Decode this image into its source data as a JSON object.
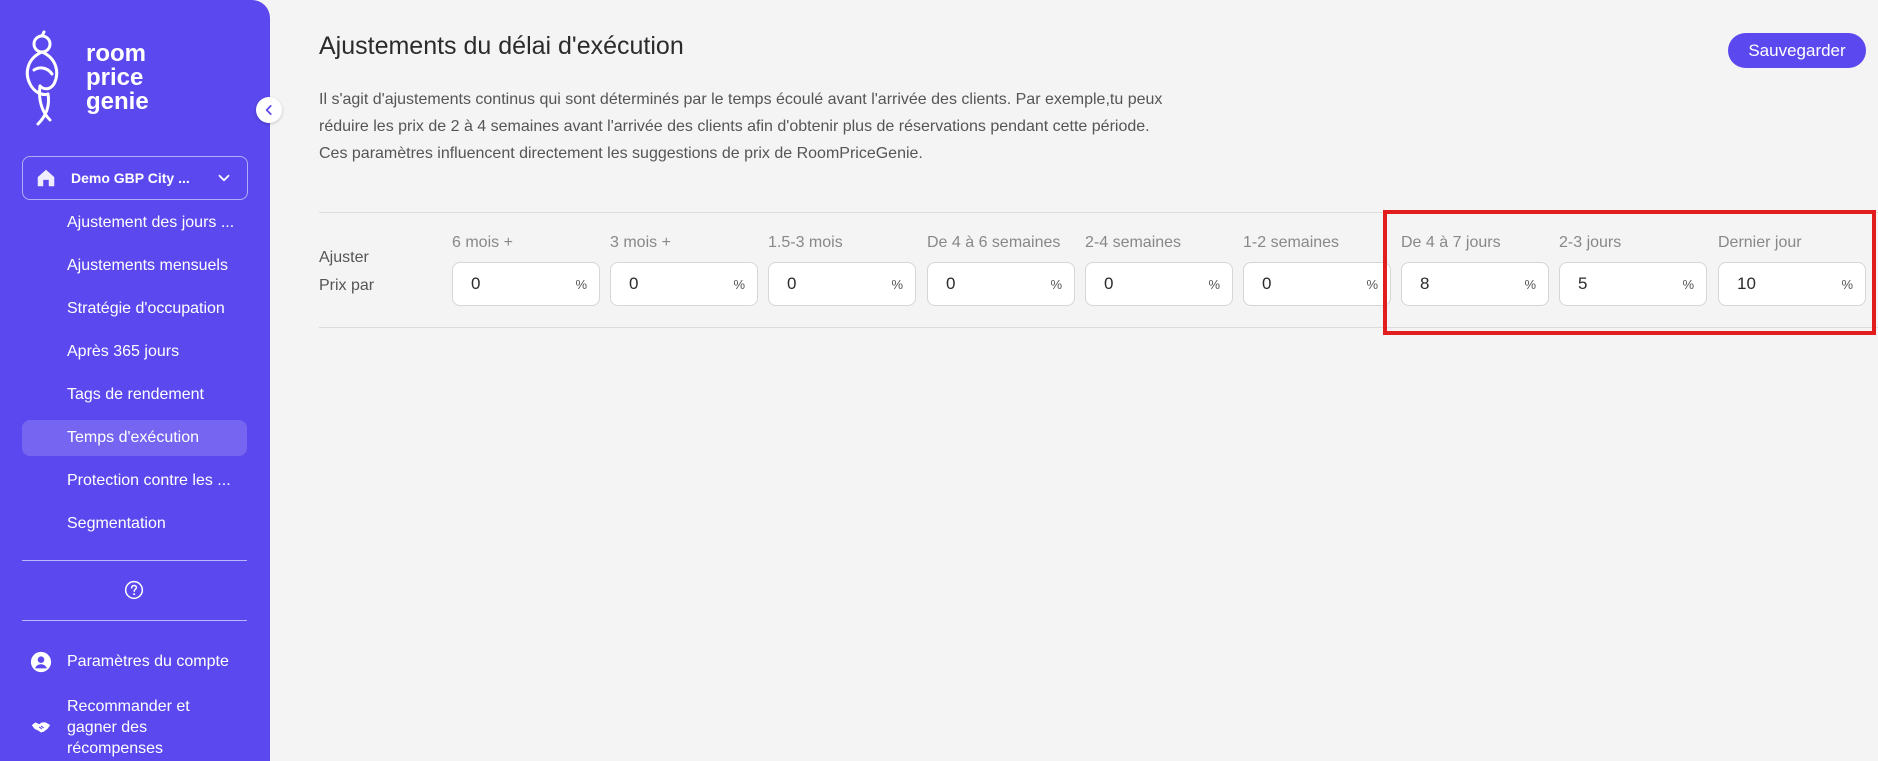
{
  "brand": {
    "logo_lines": [
      "room",
      "price",
      "genie"
    ]
  },
  "sidebar": {
    "hotel_selector": "Demo GBP City ...",
    "items": [
      {
        "label": "Ajustement des jours ...",
        "active": false
      },
      {
        "label": "Ajustements mensuels",
        "active": false
      },
      {
        "label": "Stratégie d'occupation",
        "active": false
      },
      {
        "label": "Après 365 jours",
        "active": false
      },
      {
        "label": "Tags de rendement",
        "active": false
      },
      {
        "label": "Temps d'exécution",
        "active": true
      },
      {
        "label": "Protection contre les ...",
        "active": false
      },
      {
        "label": "Segmentation",
        "active": false
      }
    ],
    "account_label": "Paramètres du compte",
    "refer_label": "Recommander et gagner des récompenses"
  },
  "main": {
    "title": "Ajustements du délai d'exécution",
    "save_label": "Sauvegarder",
    "description": "Il s'agit d'ajustements continus qui sont déterminés par le temps écoulé avant l'arrivée des clients. Par exemple,tu peux réduire les prix de 2 à 4 semaines avant l'arrivée des clients afin d'obtenir plus de réservations pendant cette période. Ces paramètres influencent directement les suggestions de prix de RoomPriceGenie.",
    "row_label_line1": "Ajuster",
    "row_label_line2": "Prix par",
    "percent_symbol": "%",
    "columns": [
      {
        "label": "6 mois +",
        "value": "0"
      },
      {
        "label": "3 mois +",
        "value": "0"
      },
      {
        "label": "1.5-3 mois",
        "value": "0"
      },
      {
        "label": "De 4 à 6 semaines",
        "value": "0"
      },
      {
        "label": "2-4 semaines",
        "value": "0"
      },
      {
        "label": "1-2 semaines",
        "value": "0"
      },
      {
        "label": "De 4 à 7 jours",
        "value": "8"
      },
      {
        "label": "2-3 jours",
        "value": "5"
      },
      {
        "label": "Dernier jour",
        "value": "10"
      }
    ]
  },
  "colors": {
    "accent": "#5b48ee",
    "highlight": "#e21d1d",
    "background": "#f3f4f3"
  }
}
